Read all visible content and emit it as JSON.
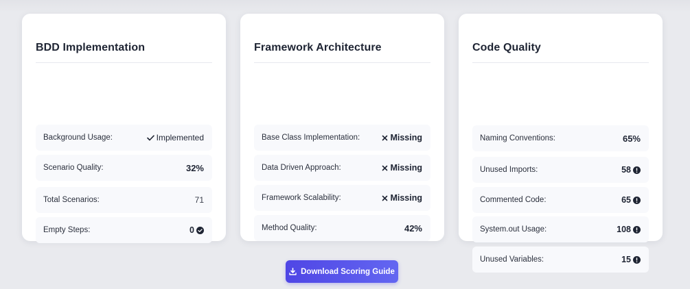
{
  "cards": [
    {
      "title": "BDD Implementation",
      "rows": [
        {
          "label": "Background Usage:",
          "value": "Implemented",
          "icon": "check-icon"
        },
        {
          "label": "Scenario Quality:",
          "value": "32%"
        },
        {
          "label": "Total Scenarios:",
          "value": "71"
        },
        {
          "label": "Empty Steps:",
          "value": "0",
          "icon": "check-circle-icon"
        }
      ]
    },
    {
      "title": "Framework Architecture",
      "rows": [
        {
          "label": "Base Class Implementation:",
          "value": "Missing",
          "icon": "x-icon"
        },
        {
          "label": "Data Driven Approach:",
          "value": "Missing",
          "icon": "x-icon"
        },
        {
          "label": "Framework Scalability:",
          "value": "Missing",
          "icon": "x-icon"
        },
        {
          "label": "Method Quality:",
          "value": "42%"
        }
      ]
    },
    {
      "title": "Code Quality",
      "rows": [
        {
          "label": "Naming Conventions:",
          "value": "65%"
        },
        {
          "label": "Unused Imports:",
          "value": "58",
          "icon": "alert-circle-icon"
        },
        {
          "label": "Commented Code:",
          "value": "65",
          "icon": "alert-circle-icon"
        },
        {
          "label": "System.out Usage:",
          "value": "108",
          "icon": "alert-circle-icon"
        },
        {
          "label": "Unused Variables:",
          "value": "15",
          "icon": "alert-circle-icon"
        }
      ]
    }
  ],
  "download_button": {
    "label": "Download Scoring Guide",
    "icon": "download-icon"
  },
  "colors": {
    "accent": "#4f46e5",
    "background": "#e9eaee",
    "card": "#ffffff",
    "row": "#f8f9fc"
  }
}
